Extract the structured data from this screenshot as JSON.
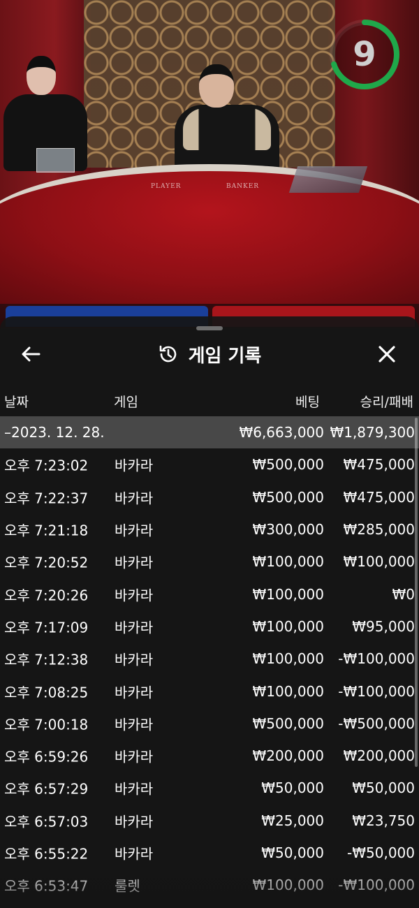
{
  "timer": {
    "value": "9",
    "color": "#1fa84a",
    "fraction_remaining": 0.7
  },
  "sheet": {
    "title": "게임 기록",
    "back_icon": "arrow-left-icon",
    "history_icon": "history-icon",
    "close_icon": "close-icon"
  },
  "columns": {
    "date": "날짜",
    "game": "게임",
    "bet": "베팅",
    "win_loss": "승리/패배"
  },
  "day_summary": {
    "date": "–2023. 12. 28.",
    "bet": "₩6,663,000",
    "win_loss": "₩1,879,300"
  },
  "rows": [
    {
      "time": "오후 7:23:02",
      "game": "바카라",
      "bet": "₩500,000",
      "win_loss": "₩475,000"
    },
    {
      "time": "오후 7:22:37",
      "game": "바카라",
      "bet": "₩500,000",
      "win_loss": "₩475,000"
    },
    {
      "time": "오후 7:21:18",
      "game": "바카라",
      "bet": "₩300,000",
      "win_loss": "₩285,000"
    },
    {
      "time": "오후 7:20:52",
      "game": "바카라",
      "bet": "₩100,000",
      "win_loss": "₩100,000"
    },
    {
      "time": "오후 7:20:26",
      "game": "바카라",
      "bet": "₩100,000",
      "win_loss": "₩0"
    },
    {
      "time": "오후 7:17:09",
      "game": "바카라",
      "bet": "₩100,000",
      "win_loss": "₩95,000"
    },
    {
      "time": "오후 7:12:38",
      "game": "바카라",
      "bet": "₩100,000",
      "win_loss": "-₩100,000"
    },
    {
      "time": "오후 7:08:25",
      "game": "바카라",
      "bet": "₩100,000",
      "win_loss": "-₩100,000"
    },
    {
      "time": "오후 7:00:18",
      "game": "바카라",
      "bet": "₩500,000",
      "win_loss": "-₩500,000"
    },
    {
      "time": "오후 6:59:26",
      "game": "바카라",
      "bet": "₩200,000",
      "win_loss": "₩200,000"
    },
    {
      "time": "오후 6:57:29",
      "game": "바카라",
      "bet": "₩50,000",
      "win_loss": "₩50,000"
    },
    {
      "time": "오후 6:57:03",
      "game": "바카라",
      "bet": "₩25,000",
      "win_loss": "₩23,750"
    },
    {
      "time": "오후 6:55:22",
      "game": "바카라",
      "bet": "₩50,000",
      "win_loss": "-₩50,000"
    },
    {
      "time": "오후 6:53:47",
      "game": "룰렛",
      "bet": "₩100,000",
      "win_loss": "-₩100,000"
    }
  ],
  "table_labels": {
    "player": "PLAYER",
    "banker": "BANKER"
  }
}
